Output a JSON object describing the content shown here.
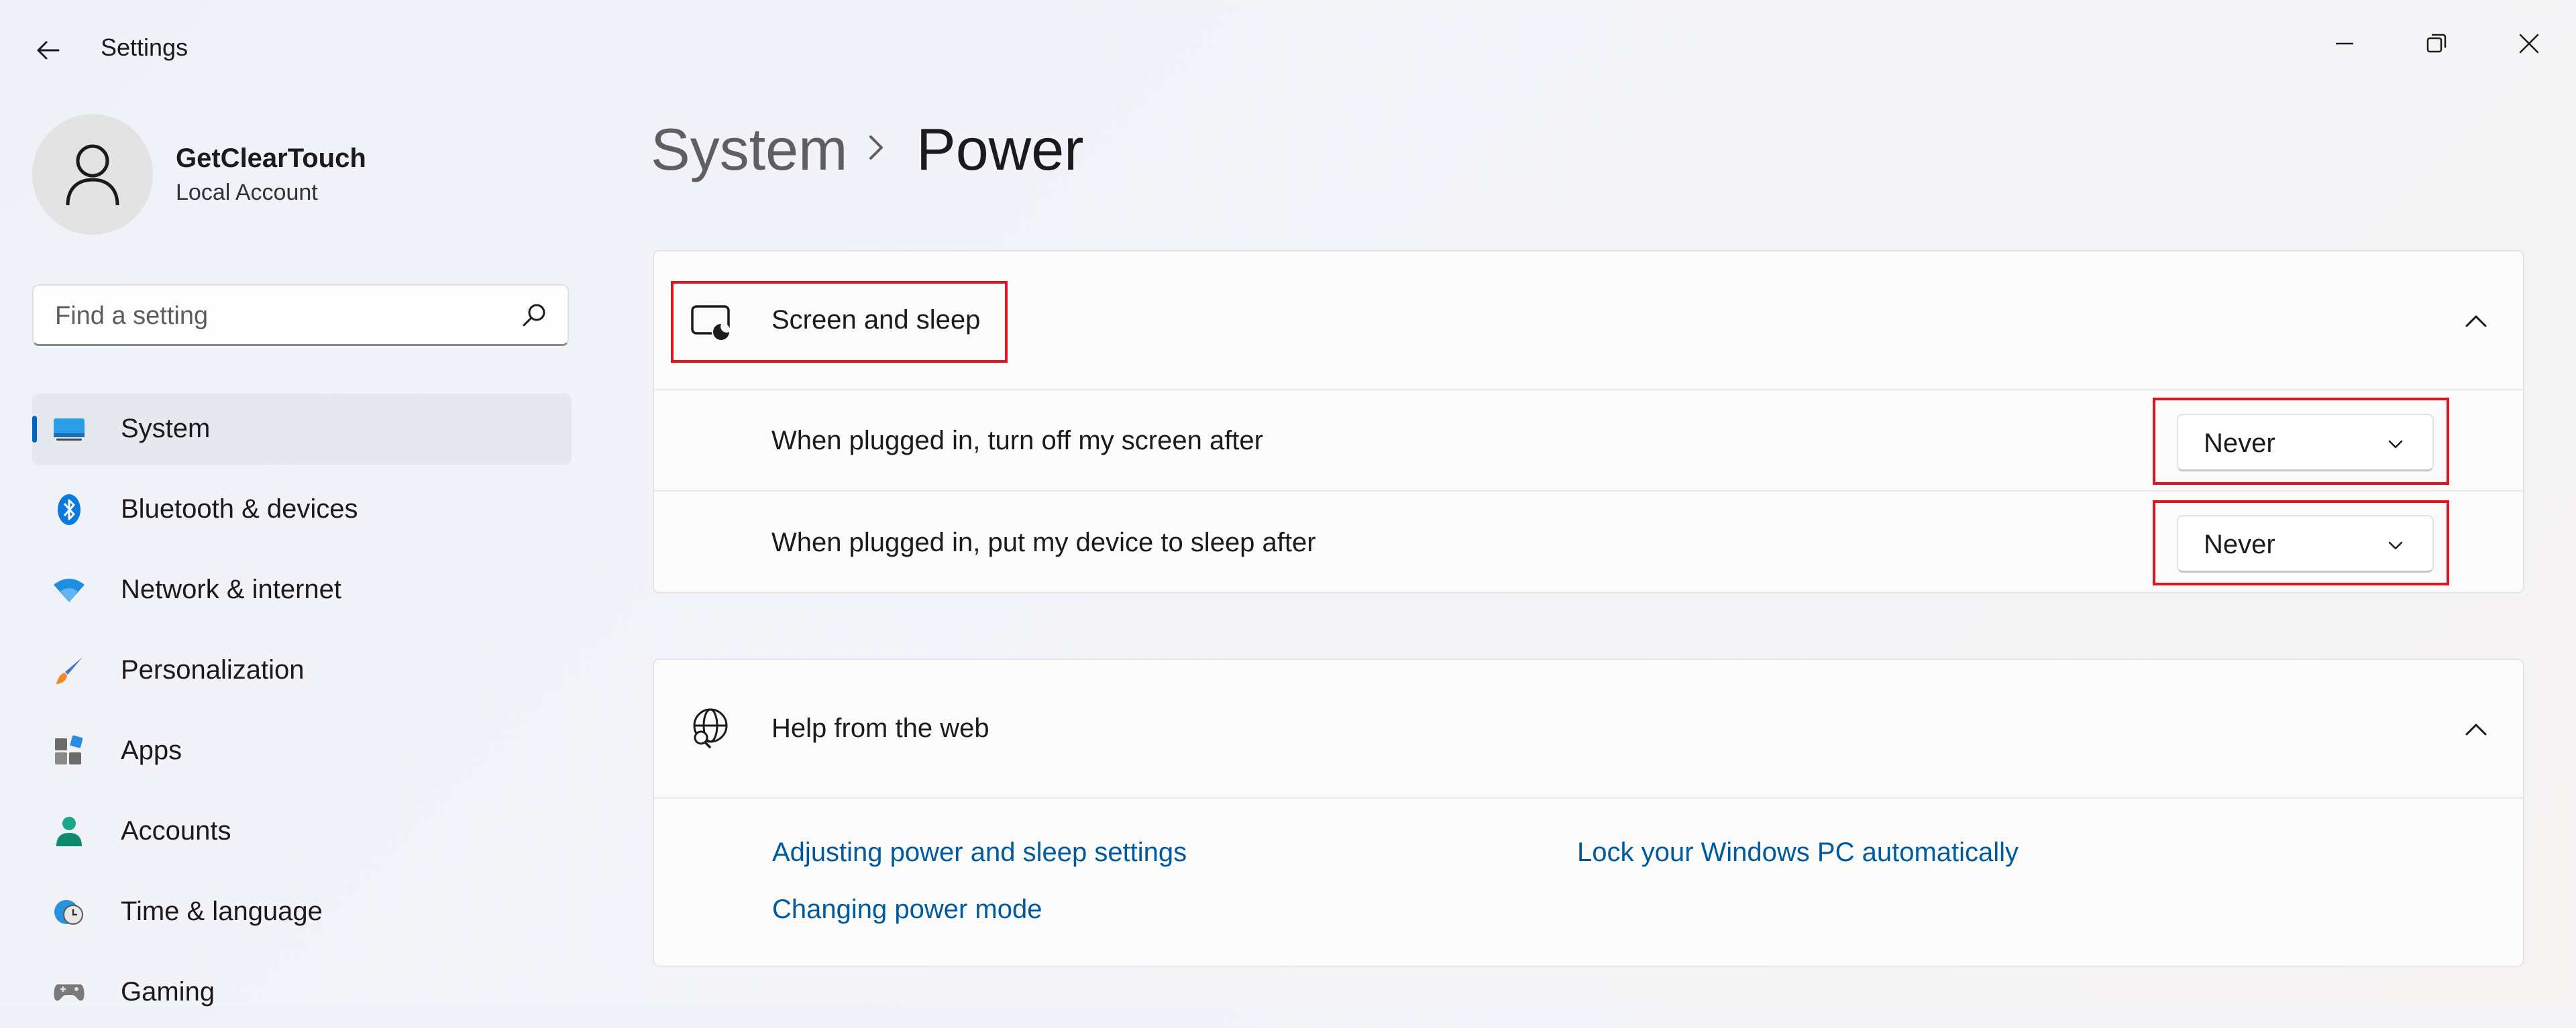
{
  "window": {
    "title": "Settings",
    "controls": [
      "minimize-icon",
      "restore-icon",
      "close-icon"
    ]
  },
  "account": {
    "name": "GetClearTouch",
    "type": "Local Account"
  },
  "search": {
    "placeholder": "Find a setting",
    "value": ""
  },
  "sidebar": {
    "items": [
      {
        "label": "System",
        "icon": "system-display-icon",
        "selected": true
      },
      {
        "label": "Bluetooth & devices",
        "icon": "bluetooth-icon"
      },
      {
        "label": "Network & internet",
        "icon": "wifi-icon"
      },
      {
        "label": "Personalization",
        "icon": "brush-icon"
      },
      {
        "label": "Apps",
        "icon": "apps-icon"
      },
      {
        "label": "Accounts",
        "icon": "person-icon"
      },
      {
        "label": "Time & language",
        "icon": "globe-clock-icon"
      },
      {
        "label": "Gaming",
        "icon": "gamepad-icon"
      }
    ]
  },
  "breadcrumb": {
    "parent": "System",
    "current": "Power"
  },
  "screen_sleep": {
    "title": "Screen and sleep",
    "icon": "screen-sleep-icon",
    "expanded": true,
    "settings": [
      {
        "label": "When plugged in, turn off my screen after",
        "value": "Never"
      },
      {
        "label": "When plugged in, put my device to sleep after",
        "value": "Never"
      }
    ]
  },
  "help": {
    "title": "Help from the web",
    "icon": "globe-search-icon",
    "expanded": true,
    "links": [
      "Adjusting power and sleep settings",
      "Lock your Windows PC automatically",
      "Changing power mode"
    ]
  },
  "colors": {
    "accent": "#0067c0",
    "link": "#005a9e",
    "highlight": "#e1131c"
  }
}
